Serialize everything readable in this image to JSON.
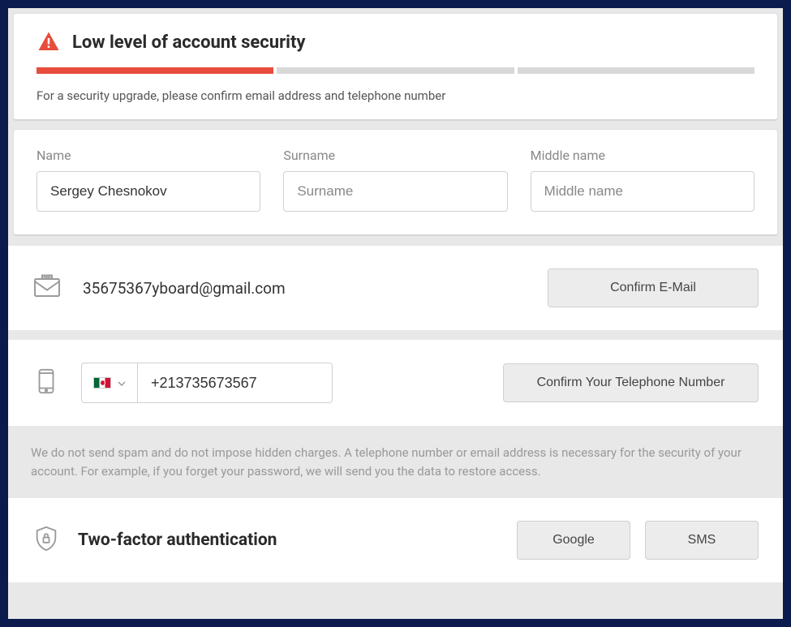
{
  "security": {
    "title": "Low level of account security",
    "description": "For a security upgrade, please confirm email address and telephone number"
  },
  "nameFields": {
    "name": {
      "label": "Name",
      "value": "Sergey Chesnokov",
      "placeholder": "Name"
    },
    "surname": {
      "label": "Surname",
      "value": "",
      "placeholder": "Surname"
    },
    "middle": {
      "label": "Middle name",
      "value": "",
      "placeholder": "Middle name"
    }
  },
  "email": {
    "address": "35675367yboard@gmail.com",
    "confirmLabel": "Confirm E-Mail"
  },
  "phone": {
    "number": "+213735673567",
    "confirmLabel": "Confirm Your Telephone Number"
  },
  "disclaimer": "We do not send spam and do not impose hidden charges. A telephone number or email address is necessary for the security of your account. For example, if you forget your password, we will send you the data to restore access.",
  "twofa": {
    "title": "Two-factor authentication",
    "google": "Google",
    "sms": "SMS"
  }
}
